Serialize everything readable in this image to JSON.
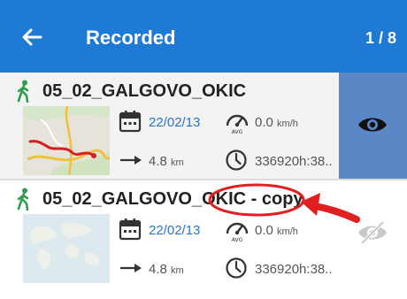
{
  "appbar": {
    "title": "Recorded",
    "counter": "1 / 8",
    "back_icon": "arrow-left-icon"
  },
  "tracks": [
    {
      "name": "05_02_GALGOVO_OKIC",
      "date": "22/02/13",
      "speed_value": "0.0",
      "speed_unit": "km/h",
      "distance_value": "4.8",
      "distance_unit": "km",
      "duration": "336920h:38..",
      "visible": true
    },
    {
      "name": "05_02_GALGOVO_OKIC",
      "name_suffix": " - copy",
      "date": "22/02/13",
      "speed_value": "0.0",
      "speed_unit": "km/h",
      "distance_value": "4.8",
      "distance_unit": "km",
      "duration": "336920h:38..",
      "visible": false
    }
  ],
  "colors": {
    "accent": "#1f7ad6",
    "visible_panel": "#5b87c6",
    "walker_green": "#2e9e4e",
    "date_blue": "#2b73c8",
    "highlight_red": "#e02020"
  }
}
